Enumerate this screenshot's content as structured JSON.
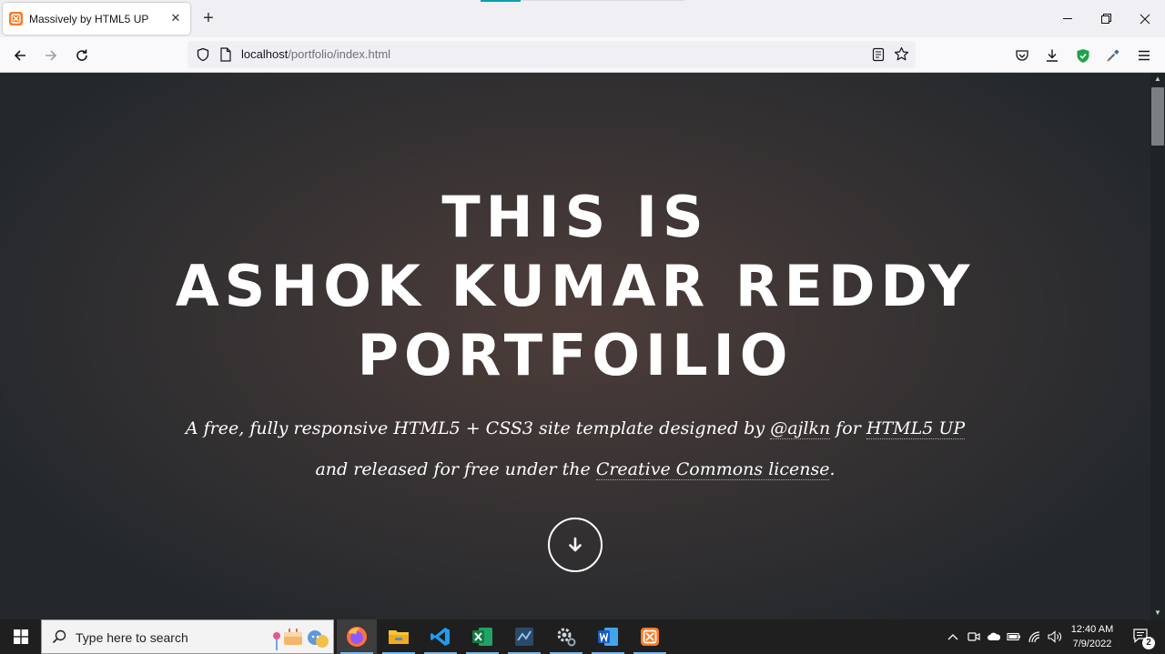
{
  "browser": {
    "tab_title": "Massively by HTML5 UP",
    "tab_close": "✕",
    "new_tab": "+",
    "url_host": "localhost",
    "url_path": "/portfolio/index.html"
  },
  "hero": {
    "title_line1": "THIS IS",
    "title_line2": "ASHOK KUMAR REDDY",
    "title_line3": "PORTFOILIO",
    "sub_line1_pre": "A free, fully responsive HTML5 + CSS3 site template designed by ",
    "sub_line1_link1": "@ajlkn",
    "sub_line1_mid": " for ",
    "sub_line1_link2": "HTML5 UP",
    "sub_line2_pre": "and released for free under the ",
    "sub_line2_link": "Creative Commons license",
    "sub_line2_post": "."
  },
  "taskbar": {
    "search_placeholder": "Type here to search",
    "time": "12:40 AM",
    "date": "7/9/2022",
    "notification_count": "2"
  },
  "colors": {
    "firefox_tab_accent": "#00a1b2",
    "xampp_orange": "#fb7a24",
    "shield_green": "#1fa34a",
    "taskbar_bg": "#1f1f1f"
  }
}
